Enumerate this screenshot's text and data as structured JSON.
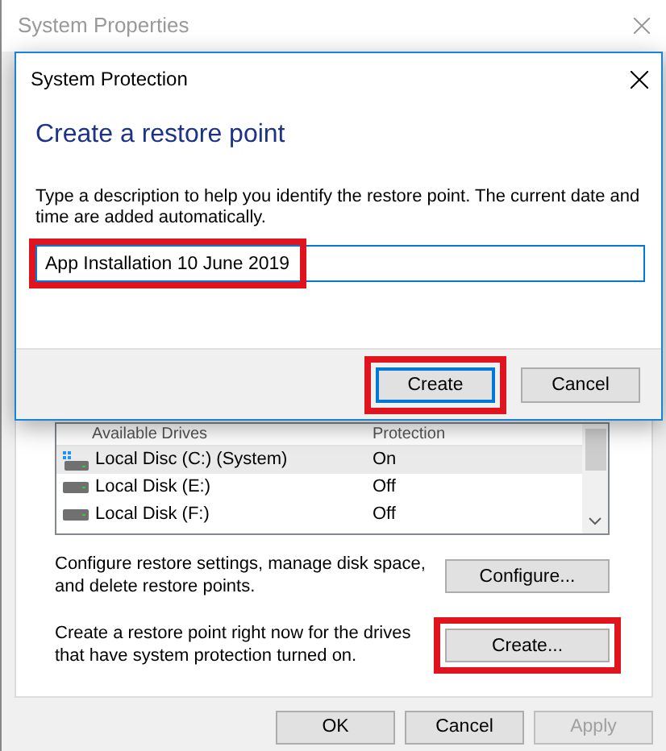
{
  "window": {
    "title": "System Properties"
  },
  "drives_list": {
    "columns": [
      "Available Drives",
      "Protection"
    ],
    "rows": [
      {
        "name": "Local Disc (C:) (System)",
        "protection": "On",
        "kind": "system",
        "selected": true
      },
      {
        "name": "Local Disk (E:)",
        "protection": "Off",
        "kind": "disk",
        "selected": false
      },
      {
        "name": "Local Disk (F:)",
        "protection": "Off",
        "kind": "disk",
        "selected": false
      }
    ]
  },
  "configure": {
    "text": "Configure restore settings, manage disk space, and delete restore points.",
    "button": "Configure...",
    "highlighted": false
  },
  "create": {
    "text": "Create a restore point right now for the drives that have system protection turned on.",
    "button": "Create...",
    "highlighted": true
  },
  "footer_buttons": [
    {
      "label": "OK",
      "disabled": false
    },
    {
      "label": "Cancel",
      "disabled": false
    },
    {
      "label": "Apply",
      "disabled": true
    }
  ],
  "dialog": {
    "title": "System Protection",
    "heading": "Create a restore point",
    "description": "Type a description to help you identify the restore point. The current date and time are added automatically.",
    "field": {
      "value": "App Installation 10 June 2019",
      "highlighted": true
    },
    "buttons": [
      {
        "label": "Create",
        "default": true,
        "highlighted": true
      },
      {
        "label": "Cancel",
        "default": false,
        "highlighted": false
      }
    ]
  }
}
